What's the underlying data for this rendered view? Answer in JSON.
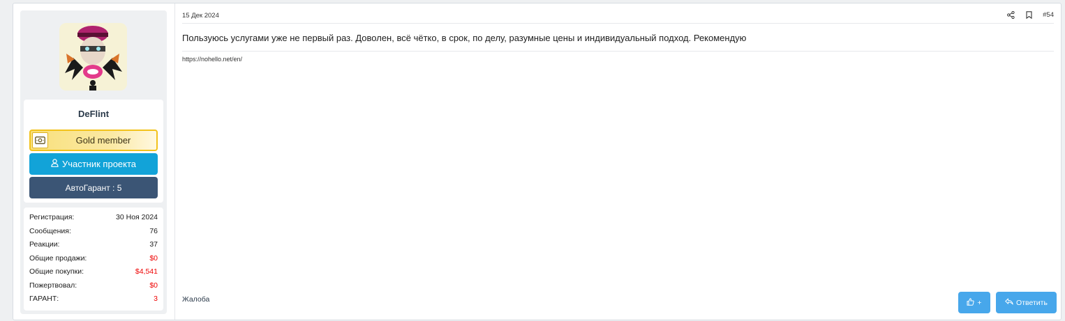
{
  "user": {
    "name": "DeFlint",
    "banner_gold": "Gold member",
    "banner_member": "Участник проекта",
    "banner_autoguarant": "АвтоГарант : 5",
    "stats": [
      {
        "label": "Регистрация:",
        "value": "30 Ноя 2024",
        "highlight": false
      },
      {
        "label": "Сообщения:",
        "value": "76",
        "highlight": false
      },
      {
        "label": "Реакции:",
        "value": "37",
        "highlight": false
      },
      {
        "label": "Общие продажи:",
        "value": "$0",
        "highlight": true
      },
      {
        "label": "Общие покупки:",
        "value": "$4,541",
        "highlight": true
      },
      {
        "label": "Пожертвовал:",
        "value": "$0",
        "highlight": true
      },
      {
        "label": "ГАРАНТ:",
        "value": "3",
        "highlight": true
      }
    ]
  },
  "post": {
    "date": "15 Дек 2024",
    "number": "#54",
    "message": "Пользуюсь услугами уже не первый раз. Доволен, всё чётко, в срок, по делу, разумные цены и индивидуальный подход. Рекомендую",
    "signature": "https://nohello.net/en/",
    "report_label": "Жалоба",
    "like_label": "+",
    "reply_label": "Ответить"
  },
  "colors": {
    "accent": "#47a7eb",
    "member_badge": "#12a3d8",
    "autoguarant_badge": "#3b5575",
    "gold": "#f2c21b",
    "highlight_value": "#e00"
  },
  "icons": [
    "share-icon",
    "bookmark-icon",
    "user-icon",
    "money-icon",
    "thumbs-up-icon",
    "reply-icon"
  ]
}
